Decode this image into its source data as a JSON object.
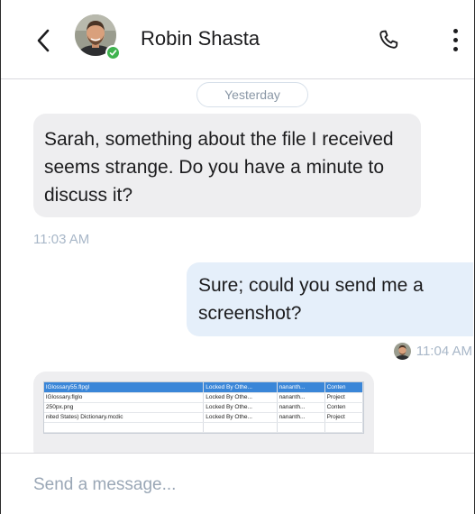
{
  "header": {
    "contact_name": "Robin Shasta",
    "back_icon": "chevron-left-icon",
    "call_icon": "phone-icon",
    "more_icon": "more-vertical-icon",
    "presence": "online",
    "presence_color": "#3fb34f"
  },
  "thread": {
    "date_divider": "Yesterday",
    "messages": [
      {
        "direction": "incoming",
        "text": "Sarah, something about the file I received seems strange. Do you have a minute to discuss it?",
        "time": "11:03 AM"
      },
      {
        "direction": "outgoing",
        "text": "Sure; could you send me a screenshot?",
        "time": "11:04 AM"
      },
      {
        "direction": "incoming",
        "type": "image",
        "image_rows": [
          [
            "lGlossary55.flpgl",
            "Locked By Othe...",
            "nananth...",
            "Conten"
          ],
          [
            "lGlossary.flglo",
            "Locked By Othe...",
            "nananth...",
            "Project"
          ],
          [
            "250px.png",
            "Locked By Othe...",
            "nananth...",
            "Conten"
          ],
          [
            "nited States) Dictionary.mcdic",
            "Locked By Othe...",
            "nananth...",
            "Project"
          ],
          [
            "",
            "",
            "",
            ""
          ]
        ]
      }
    ]
  },
  "composer": {
    "placeholder": "Send a message..."
  },
  "colors": {
    "incoming_bubble": "#eeeef0",
    "outgoing_bubble": "#e5effa",
    "timestamp": "#a8b7c8"
  }
}
